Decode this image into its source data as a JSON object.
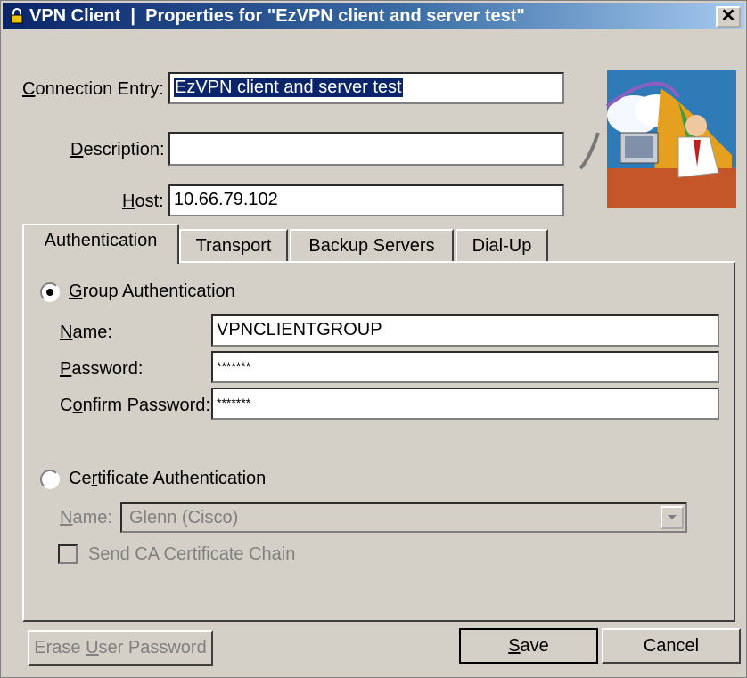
{
  "title": {
    "app": "VPN Client",
    "separator": "|",
    "text": "Properties for \"EzVPN client and server test\""
  },
  "close_glyph": "✕",
  "form": {
    "connection_entry": {
      "label_u": "C",
      "label_rest": "onnection Entry:",
      "value": "EzVPN client and server test"
    },
    "description": {
      "label_u": "D",
      "label_rest": "escription:",
      "value": ""
    },
    "host": {
      "label_u": "H",
      "label_rest": "ost:",
      "value": "10.66.79.102"
    }
  },
  "tabs": [
    "Authentication",
    "Transport",
    "Backup Servers",
    "Dial-Up"
  ],
  "auth": {
    "group": {
      "label_u": "G",
      "label_rest": "roup Authentication",
      "selected": true,
      "name_label_u": "N",
      "name_label_rest": "ame:",
      "name_value": "VPNCLIENTGROUP",
      "password_label_u": "P",
      "password_label_rest": "assword:",
      "password_value": "*******",
      "confirm_label_pre": "C",
      "confirm_label_u": "o",
      "confirm_label_rest": "nfirm Password:",
      "confirm_value": "*******"
    },
    "certificate": {
      "label_pre": "Ce",
      "label_u": "r",
      "label_rest": "tificate Authentication",
      "selected": false,
      "name_label_u": "N",
      "name_label_rest": "ame:",
      "name_value": "Glenn (Cisco)",
      "chain_label": "Send CA Certificate Chain"
    }
  },
  "buttons": {
    "erase_pre": "Erase ",
    "erase_u": "U",
    "erase_rest": "ser Password",
    "save_u": "S",
    "save_rest": "ave",
    "cancel": "Cancel"
  }
}
